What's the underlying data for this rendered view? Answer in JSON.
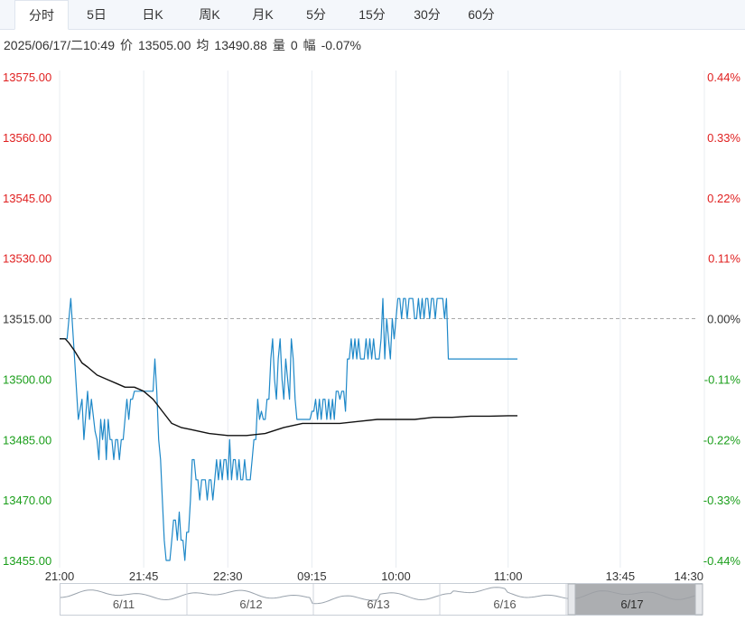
{
  "tabs": [
    {
      "label": "分时",
      "active": true
    },
    {
      "label": "5日",
      "active": false
    },
    {
      "label": "日K",
      "active": false
    },
    {
      "label": "周K",
      "active": false
    },
    {
      "label": "月K",
      "active": false
    },
    {
      "label": "5分",
      "active": false
    },
    {
      "label": "15分",
      "active": false
    },
    {
      "label": "30分",
      "active": false
    },
    {
      "label": "60分",
      "active": false
    }
  ],
  "info": {
    "datetime": "2025/06/17/二10:49",
    "price_label": "价",
    "price": "13505.00",
    "avg_label": "均",
    "avg": "13490.88",
    "volume_label": "量",
    "volume": "0",
    "change_label": "幅",
    "change": "-0.07%"
  },
  "colors": {
    "up": "#e02020",
    "down": "#1a9e1a",
    "price_line": "#1e88c8",
    "avg_line": "#111111",
    "grid": "#e8ecf1",
    "ref_line": "#aaaaaa"
  },
  "chart_data": {
    "type": "line",
    "x_ticks": [
      "21:00",
      "21:45",
      "22:30",
      "09:15",
      "10:00",
      "11:00",
      "13:45",
      "14:30"
    ],
    "y_ticks": [
      "13575.00",
      "13560.00",
      "13545.00",
      "13530.00",
      "13515.00",
      "13500.00",
      "13485.00",
      "13470.00",
      "13455.00"
    ],
    "y_ticks_right": [
      "0.44%",
      "0.33%",
      "0.22%",
      "0.11%",
      "0.00%",
      "-0.11%",
      "-0.22%",
      "-0.33%",
      "-0.44%"
    ],
    "ylim": [
      13455,
      13575
    ],
    "reference_price": 13515,
    "total_minutes": 345,
    "series": [
      {
        "kind": "price",
        "t": [
          0,
          2,
          4,
          6,
          8,
          10,
          12,
          13,
          15,
          16,
          17,
          19,
          20,
          21,
          22,
          23,
          24,
          25,
          26,
          27,
          28,
          29,
          30,
          31,
          32,
          33,
          34,
          35,
          36,
          37,
          38,
          39,
          40,
          41,
          42,
          43,
          44,
          45,
          46,
          47,
          48,
          49,
          50,
          51,
          52,
          53,
          54,
          55,
          56,
          57,
          58,
          59,
          60,
          61,
          62,
          63,
          64,
          65,
          66,
          67,
          68,
          69,
          70,
          71,
          72,
          73,
          74,
          75,
          76,
          77,
          78,
          79,
          80,
          81,
          82,
          83,
          84,
          85,
          86,
          87,
          88,
          89,
          90,
          91,
          92,
          93,
          94,
          95,
          96,
          97,
          98,
          99,
          100,
          101,
          102,
          103,
          104,
          105,
          106,
          107,
          108,
          109,
          110,
          111,
          112,
          113,
          114,
          115,
          116,
          117,
          118,
          119,
          120,
          121,
          122,
          123,
          124,
          125,
          126,
          127,
          128,
          129,
          130,
          131,
          132,
          133,
          134,
          135,
          136,
          137,
          138,
          139,
          140,
          141,
          142,
          143,
          144,
          145,
          146,
          147,
          148,
          149,
          150,
          151,
          152,
          153,
          154,
          155,
          156,
          157,
          158,
          159,
          160,
          161,
          162,
          163,
          164,
          165,
          166,
          167,
          168,
          169,
          170,
          171,
          172,
          173,
          174,
          175,
          176,
          177,
          178,
          179,
          180,
          181,
          182,
          183,
          184,
          185,
          186,
          187,
          188,
          189,
          190,
          191,
          192,
          193,
          194,
          195,
          196,
          197,
          198,
          199,
          200,
          201,
          202,
          203,
          204,
          205,
          206,
          207,
          208,
          209,
          210,
          211,
          212,
          213,
          214,
          215,
          216,
          217,
          218,
          219,
          220,
          221,
          222,
          223,
          224,
          225,
          226,
          227,
          228,
          229,
          230,
          231,
          232,
          233,
          234,
          235,
          236,
          237,
          238,
          239,
          240,
          241,
          242,
          243,
          244,
          245
        ],
        "y": [
          13510,
          13510,
          13510,
          13520,
          13505,
          13490,
          13495,
          13485,
          13497,
          13490,
          13495,
          13487,
          13485,
          13480,
          13490,
          13485,
          13490,
          13480,
          13490,
          13485,
          13485,
          13480,
          13485,
          13485,
          13480,
          13485,
          13485,
          13490,
          13495,
          13490,
          13495,
          13495,
          13497,
          13497,
          13497,
          13497,
          13497,
          13497,
          13497,
          13497,
          13497,
          13497,
          13497,
          13505,
          13497,
          13485,
          13480,
          13470,
          13460,
          13455,
          13455,
          13455,
          13460,
          13465,
          13465,
          13460,
          13467,
          13460,
          13460,
          13455,
          13462,
          13462,
          13470,
          13480,
          13480,
          13475,
          13475,
          13470,
          13475,
          13475,
          13475,
          13470,
          13475,
          13475,
          13470,
          13475,
          13480,
          13475,
          13480,
          13475,
          13480,
          13480,
          13475,
          13485,
          13475,
          13480,
          13480,
          13475,
          13480,
          13475,
          13475,
          13480,
          13475,
          13475,
          13475,
          13480,
          13485,
          13485,
          13495,
          13490,
          13492,
          13490,
          13490,
          13495,
          13495,
          13505,
          13510,
          13500,
          13495,
          13505,
          13510,
          13500,
          13495,
          13505,
          13500,
          13495,
          13510,
          13505,
          13495,
          13490,
          13490,
          13490,
          13490,
          13490,
          13490,
          13490,
          13490,
          13492,
          13492,
          13495,
          13490,
          13495,
          13490,
          13495,
          13495,
          13490,
          13495,
          13490,
          13495,
          13490,
          13497,
          13497,
          13495,
          13497,
          13497,
          13492,
          13505,
          13505,
          13510,
          13505,
          13510,
          13505,
          13510,
          13505,
          13505,
          13505,
          13510,
          13505,
          13510,
          13505,
          13510,
          13505,
          13505,
          13505,
          13510,
          13520,
          13505,
          13515,
          13510,
          13505,
          13515,
          13510,
          13515,
          13520,
          13520,
          13515,
          13520,
          13520,
          13515,
          13520,
          13520,
          13520,
          13515,
          13515,
          13520,
          13515,
          13520,
          13515,
          13520,
          13520,
          13515,
          13520,
          13520,
          13515,
          13520,
          13520,
          13520,
          13520,
          13515,
          13520,
          13505,
          13505,
          13505,
          13505,
          13505,
          13505,
          13505,
          13505,
          13505,
          13505,
          13505,
          13505,
          13505,
          13505,
          13505,
          13505,
          13505,
          13505,
          13505,
          13505,
          13505,
          13505,
          13505,
          13505,
          13505,
          13505,
          13505,
          13505,
          13505,
          13505,
          13505,
          13505,
          13505,
          13505,
          13505,
          13505,
          13505,
          13505,
          13505,
          13505,
          13505,
          13505
        ]
      },
      {
        "kind": "average",
        "t": [
          0,
          3,
          5,
          8,
          12,
          15,
          20,
          25,
          30,
          35,
          40,
          45,
          50,
          55,
          60,
          65,
          70,
          80,
          90,
          100,
          110,
          120,
          130,
          140,
          150,
          160,
          170,
          180,
          190,
          200,
          210,
          220,
          230,
          240,
          245
        ],
        "y": [
          13510,
          13510,
          13509,
          13507,
          13504,
          13503,
          13501,
          13500,
          13499,
          13498,
          13498,
          13497,
          13495,
          13492,
          13489,
          13488,
          13487.5,
          13486.5,
          13486,
          13486,
          13486.5,
          13488,
          13489,
          13489,
          13489,
          13489.5,
          13490,
          13490,
          13490,
          13490.5,
          13490.5,
          13490.8,
          13490.8,
          13490.9,
          13490.9
        ]
      }
    ],
    "navigator_labels": [
      "6/11",
      "6/12",
      "6/13",
      "6/16",
      "6/17"
    ]
  }
}
